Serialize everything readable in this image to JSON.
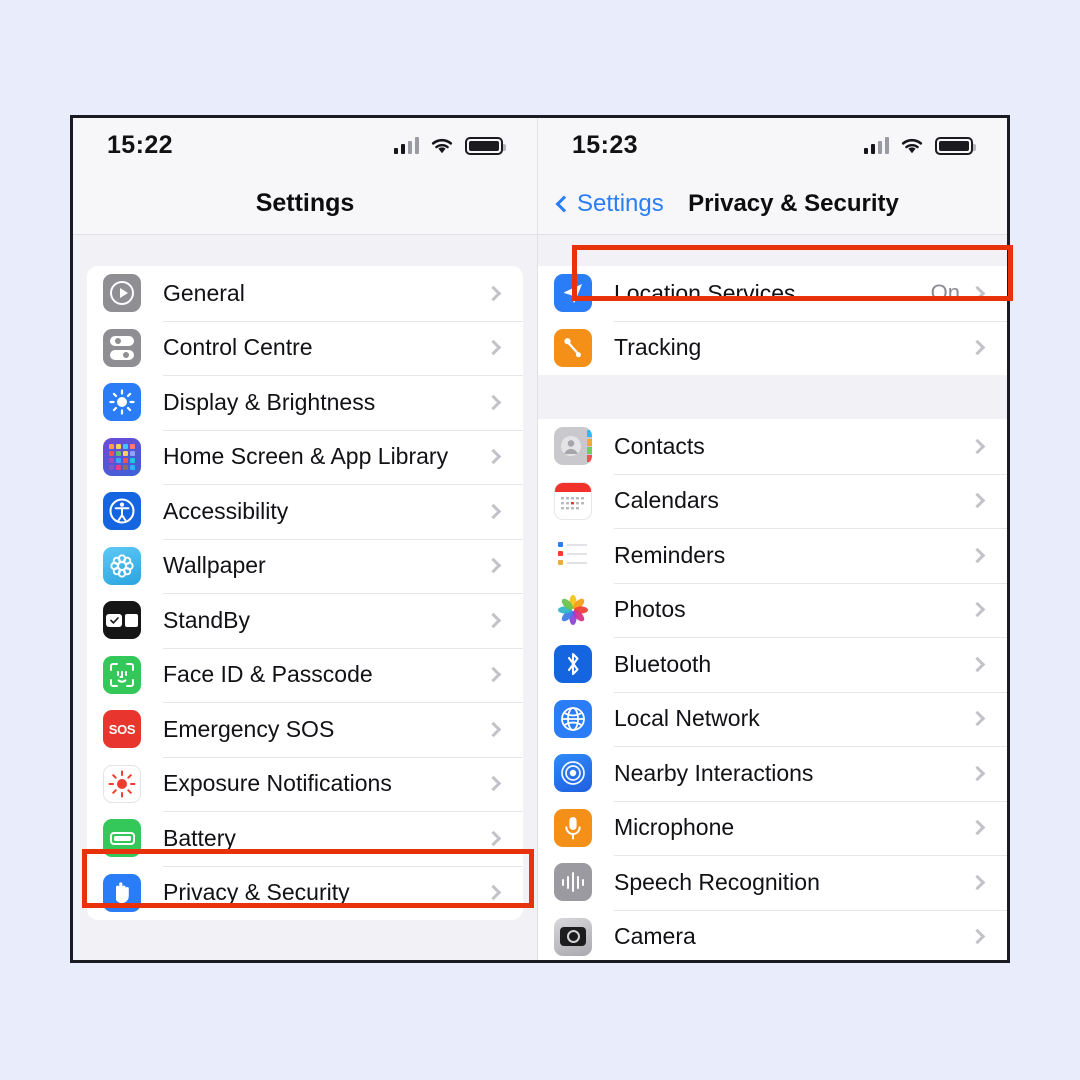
{
  "background_color": "#e9ecfb",
  "highlight_color": "#e8320c",
  "accent_blue": "#2a7cf7",
  "left_screen": {
    "status_bar": {
      "time": "15:22",
      "cellular_icon": "cellular-signal-icon",
      "wifi_icon": "wifi-icon",
      "battery_icon": "battery-full-icon"
    },
    "nav": {
      "title": "Settings"
    },
    "groups": [
      {
        "items": [
          {
            "label": "General",
            "icon": "general-gear-icon",
            "value": ""
          },
          {
            "label": "Control Centre",
            "icon": "control-centre-icon",
            "value": ""
          },
          {
            "label": "Display & Brightness",
            "icon": "display-brightness-icon",
            "value": ""
          },
          {
            "label": "Home Screen & App Library",
            "icon": "home-screen-icon",
            "value": ""
          },
          {
            "label": "Accessibility",
            "icon": "accessibility-icon",
            "value": ""
          },
          {
            "label": "Wallpaper",
            "icon": "wallpaper-icon",
            "value": ""
          },
          {
            "label": "StandBy",
            "icon": "standby-icon",
            "value": ""
          },
          {
            "label": "Face ID & Passcode",
            "icon": "face-id-icon",
            "value": ""
          },
          {
            "label": "Emergency SOS",
            "icon": "emergency-sos-icon",
            "value": "SOS"
          },
          {
            "label": "Exposure Notifications",
            "icon": "exposure-notifications-icon",
            "value": ""
          },
          {
            "label": "Battery",
            "icon": "battery-icon",
            "value": ""
          },
          {
            "label": "Privacy & Security",
            "icon": "privacy-hand-icon",
            "value": ""
          }
        ]
      }
    ],
    "highlighted_row": "Privacy & Security"
  },
  "right_screen": {
    "status_bar": {
      "time": "15:23",
      "cellular_icon": "cellular-signal-icon",
      "wifi_icon": "wifi-icon",
      "battery_icon": "battery-full-icon"
    },
    "nav": {
      "back_label": "Settings",
      "back_icon": "chevron-left-icon",
      "title": "Privacy & Security"
    },
    "groups": [
      {
        "items": [
          {
            "label": "Location Services",
            "icon": "location-services-icon",
            "value": "On"
          },
          {
            "label": "Tracking",
            "icon": "tracking-icon",
            "value": ""
          }
        ]
      },
      {
        "items": [
          {
            "label": "Contacts",
            "icon": "contacts-icon",
            "value": ""
          },
          {
            "label": "Calendars",
            "icon": "calendars-icon",
            "value": ""
          },
          {
            "label": "Reminders",
            "icon": "reminders-icon",
            "value": ""
          },
          {
            "label": "Photos",
            "icon": "photos-icon",
            "value": ""
          },
          {
            "label": "Bluetooth",
            "icon": "bluetooth-icon",
            "value": ""
          },
          {
            "label": "Local Network",
            "icon": "local-network-icon",
            "value": ""
          },
          {
            "label": "Nearby Interactions",
            "icon": "nearby-interactions-icon",
            "value": ""
          },
          {
            "label": "Microphone",
            "icon": "microphone-icon",
            "value": ""
          },
          {
            "label": "Speech Recognition",
            "icon": "speech-recognition-icon",
            "value": ""
          },
          {
            "label": "Camera",
            "icon": "camera-icon",
            "value": ""
          }
        ]
      }
    ],
    "highlighted_row": "Location Services"
  }
}
